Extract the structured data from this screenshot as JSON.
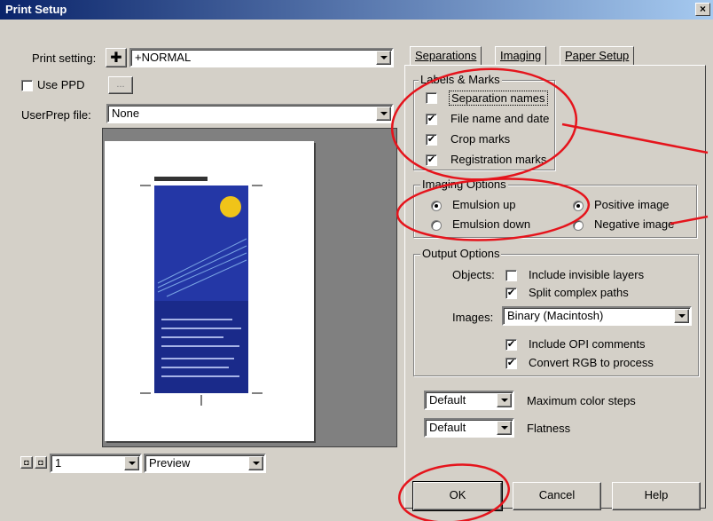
{
  "window": {
    "title": "Print Setup",
    "close_label": "×"
  },
  "left": {
    "print_setting_label": "Print setting:",
    "print_setting_value": "+NORMAL",
    "use_ppd_label": "Use PPD",
    "use_ppd_checked": false,
    "ppd_browse_label": "...",
    "userprep_label": "UserPrep file:",
    "userprep_value": "None",
    "page_number": "1",
    "view_mode": "Preview"
  },
  "tabs": [
    "Separations",
    "Imaging",
    "Paper Setup"
  ],
  "labels_marks": {
    "title": "Labels & Marks",
    "items": [
      {
        "label": "Separation names",
        "checked": false
      },
      {
        "label": "File name and date",
        "checked": true
      },
      {
        "label": "Crop marks",
        "checked": true
      },
      {
        "label": "Registration marks",
        "checked": true
      }
    ]
  },
  "imaging_options": {
    "title": "Imaging Options",
    "emulsion_up": "Emulsion up",
    "emulsion_down": "Emulsion down",
    "positive_image": "Positive image",
    "negative_image": "Negative image"
  },
  "output_options": {
    "title": "Output Options",
    "objects_label": "Objects:",
    "include_invisible": "Include invisible layers",
    "split_paths": "Split complex paths",
    "images_label": "Images:",
    "images_value": "Binary (Macintosh)",
    "include_opi": "Include OPI comments",
    "convert_rgb": "Convert RGB to process"
  },
  "color_steps": {
    "value": "Default",
    "label": "Maximum color steps"
  },
  "flatness": {
    "value": "Default",
    "label": "Flatness"
  },
  "buttons": {
    "ok": "OK",
    "cancel": "Cancel",
    "help": "Help"
  },
  "colors": {
    "annotation": "#e5141c",
    "titlebar": "#0a246a"
  }
}
